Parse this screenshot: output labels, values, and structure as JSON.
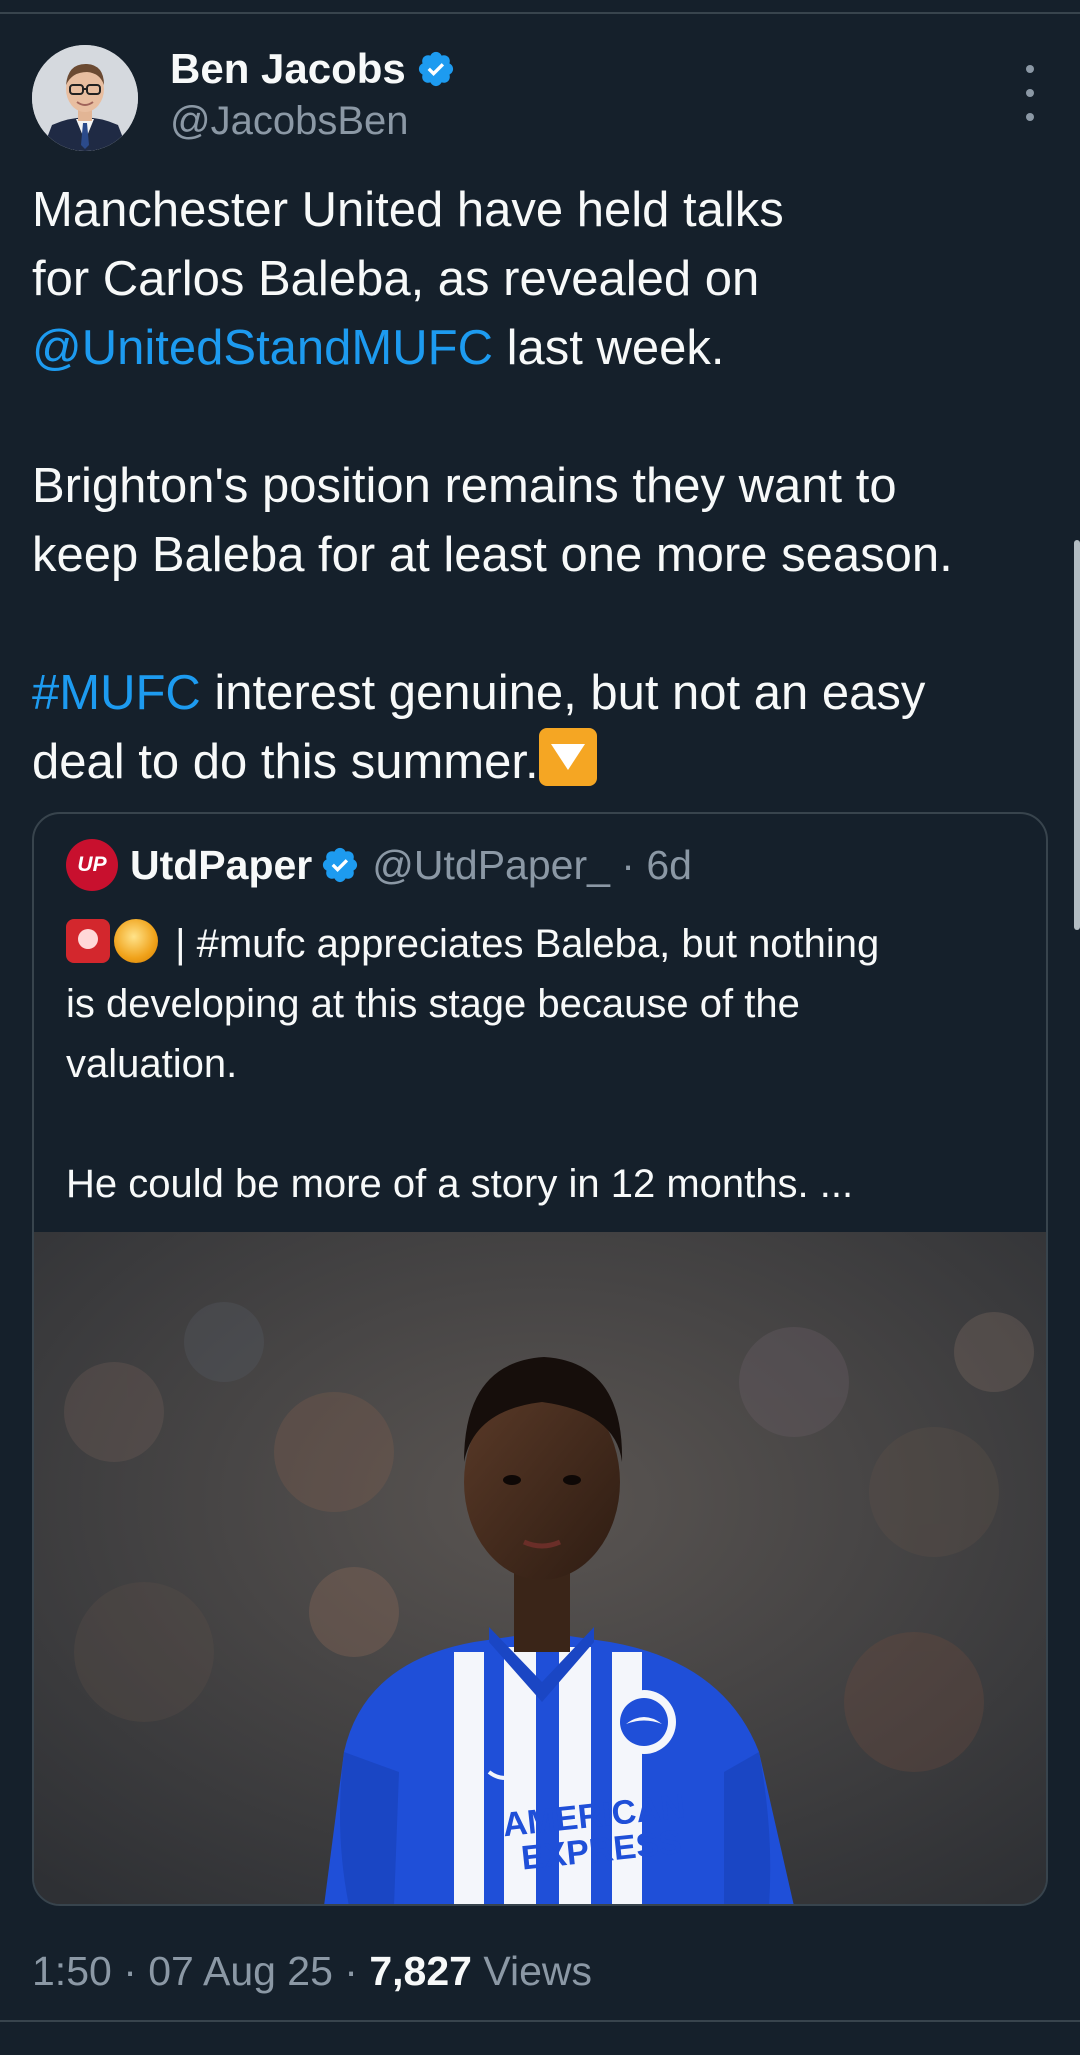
{
  "tweet": {
    "author_name": "Ben Jacobs",
    "author_handle": "@JacobsBen",
    "verified_icon": "verified-badge-icon",
    "more_icon": "more-vertical-icon",
    "text": {
      "p1_line1": "Manchester United have held talks",
      "p1_line2": "for Carlos Baleba, as revealed on",
      "p1_mention": "@UnitedStandMUFC",
      "p1_rest": " last week.",
      "p2_line1": "Brighton's position remains they want to",
      "p2_line2": "keep Baleba for at least one more season.",
      "p3_hashtag": "#MUFC",
      "p3_rest": " interest genuine, but not an easy",
      "p3_line2": "deal to do this summer.",
      "emoji": "down-arrow-emoji"
    },
    "timestamp": "1:50 · 07 Aug 25 · ",
    "views_count": "7,827",
    "views_label": " Views"
  },
  "quote": {
    "avatar_text": "UP",
    "name": "UtdPaper",
    "handle": "@UtdPaper_ · 6d",
    "text_line1": " | #mufc appreciates Baleba, but nothing",
    "text_line2": "is developing at this stage because of the",
    "text_line3": "valuation.",
    "text_line4": "He could be more of a story in 12 months. ...",
    "emojis": [
      "siren-emoji",
      "circle-emoji"
    ],
    "media": "footballer-photo",
    "shirt_sponsor_line1": "AMERICAN",
    "shirt_sponsor_line2": "EXPRESS"
  },
  "colors": {
    "background": "#15202b",
    "text": "#f7f9f9",
    "secondary": "#8b98a5",
    "link": "#1d9bf0",
    "border": "#38444d",
    "kit_blue": "#1f4fd8"
  }
}
